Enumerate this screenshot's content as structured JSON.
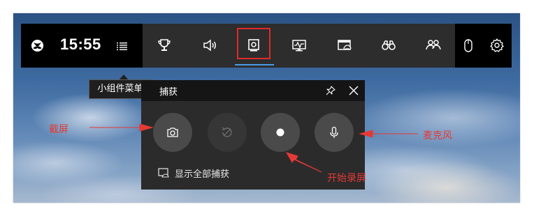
{
  "gamebar": {
    "time": "15:55",
    "icons": [
      "xbox-logo",
      "widget-menu",
      "achievements-trophy",
      "audio",
      "capture",
      "performance",
      "xbox-social-gaming",
      "looking-for-group",
      "social",
      "mouse",
      "settings"
    ]
  },
  "tooltip": {
    "text": "小组件菜单"
  },
  "capture_widget": {
    "title": "捕获",
    "buttons": [
      {
        "name": "screenshot",
        "icon": "camera"
      },
      {
        "name": "record-last",
        "icon": "record-that",
        "disabled": true
      },
      {
        "name": "start-recording",
        "icon": "record-dot"
      },
      {
        "name": "microphone",
        "icon": "microphone"
      }
    ],
    "show_all_captures": "显示全部捕获"
  },
  "annotations": {
    "screenshot": "截屏",
    "start_recording": "开始录屏",
    "microphone": "麦克风",
    "color": "#e53935"
  },
  "colors": {
    "bar_bg": "#2d2d2d",
    "highlight": "#e02a2a",
    "active_underline": "#4c9be8"
  }
}
